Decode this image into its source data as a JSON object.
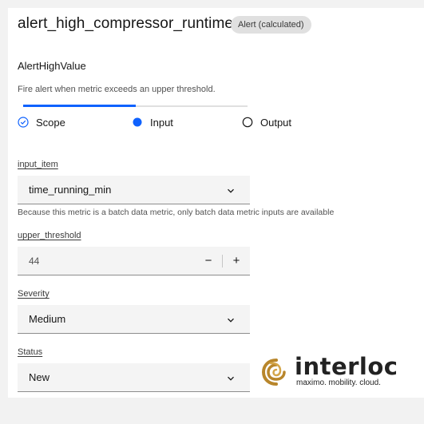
{
  "header": {
    "title": "alert_high_compressor_runtime",
    "tag": "Alert (calculated)"
  },
  "function": {
    "name": "AlertHighValue",
    "description": "Fire alert when metric exceeds an upper threshold."
  },
  "steps": [
    {
      "label": "Scope",
      "status": "complete"
    },
    {
      "label": "Input",
      "status": "current"
    },
    {
      "label": "Output",
      "status": "incomplete"
    }
  ],
  "progress": 0.5,
  "input_item": {
    "label": "input_item",
    "value": "time_running_min",
    "helper": "Because this metric is a batch data metric, only batch data metric inputs are available"
  },
  "upper_threshold": {
    "label": "upper_threshold",
    "value": "44",
    "decrement": "−",
    "increment": "+"
  },
  "severity": {
    "label": "Severity",
    "value": "Medium"
  },
  "status": {
    "label": "Status",
    "value": "New"
  },
  "logo": {
    "wordmark": "interloc",
    "tagline": "maximo. mobility. cloud."
  },
  "colors": {
    "accent": "#0f62fe",
    "logo_gold": "#b8862b",
    "text": "#161616"
  }
}
